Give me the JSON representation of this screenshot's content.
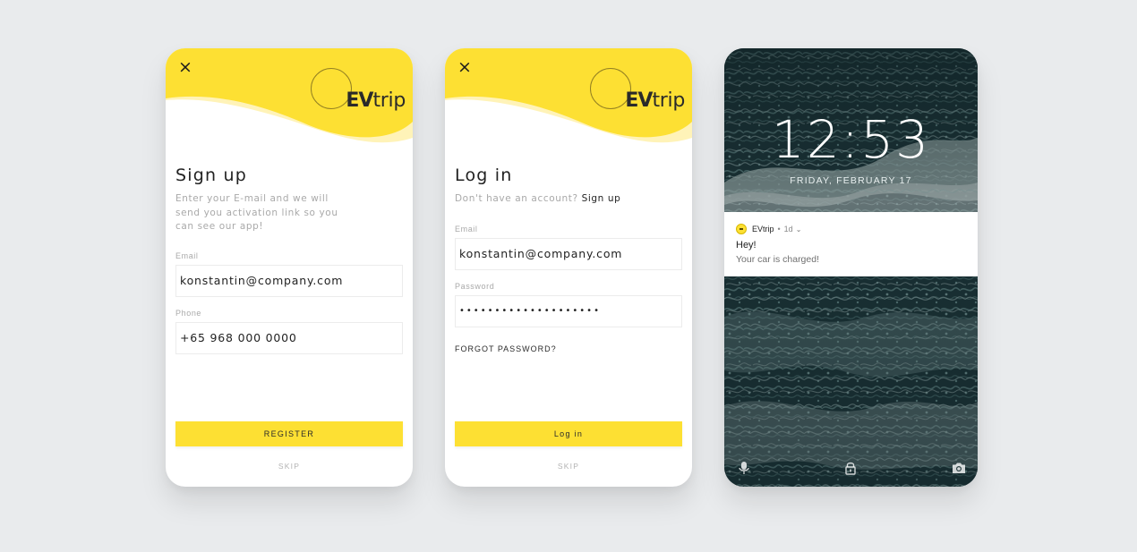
{
  "brand": {
    "logo_bold": "EV",
    "logo_light": "trip",
    "accent_color": "#fde033"
  },
  "signup": {
    "close_icon": "×",
    "title": "Sign up",
    "description": "Enter your E-mail and we will send you activation link so you can see our app!",
    "email_label": "Email",
    "email_value": "konstantin@company.com",
    "phone_label": "Phone",
    "phone_value": "+65 968 000 0000",
    "register_label": "REGISTER",
    "skip_label": "SKIP"
  },
  "login": {
    "close_icon": "×",
    "title": "Log in",
    "no_account_text": "Don't have an account?",
    "signup_link": "Sign up",
    "email_label": "Email",
    "email_value": "konstantin@company.com",
    "password_label": "Password",
    "password_value": "••••••••••••••••••••",
    "forgot_label": "FORGOT PASSWORD?",
    "login_button_label": "Log in",
    "skip_label": "SKIP"
  },
  "lockscreen": {
    "time": "12:53",
    "date": "FRIDAY, FEBRUARY 17",
    "notification": {
      "app": "EVtrip",
      "separator": "•",
      "age": "1d",
      "chevron": "⌄",
      "title": "Hey!",
      "body": "Your car is charged!"
    },
    "bottom_icons": [
      "mic-icon",
      "lock-icon",
      "camera-icon"
    ]
  }
}
